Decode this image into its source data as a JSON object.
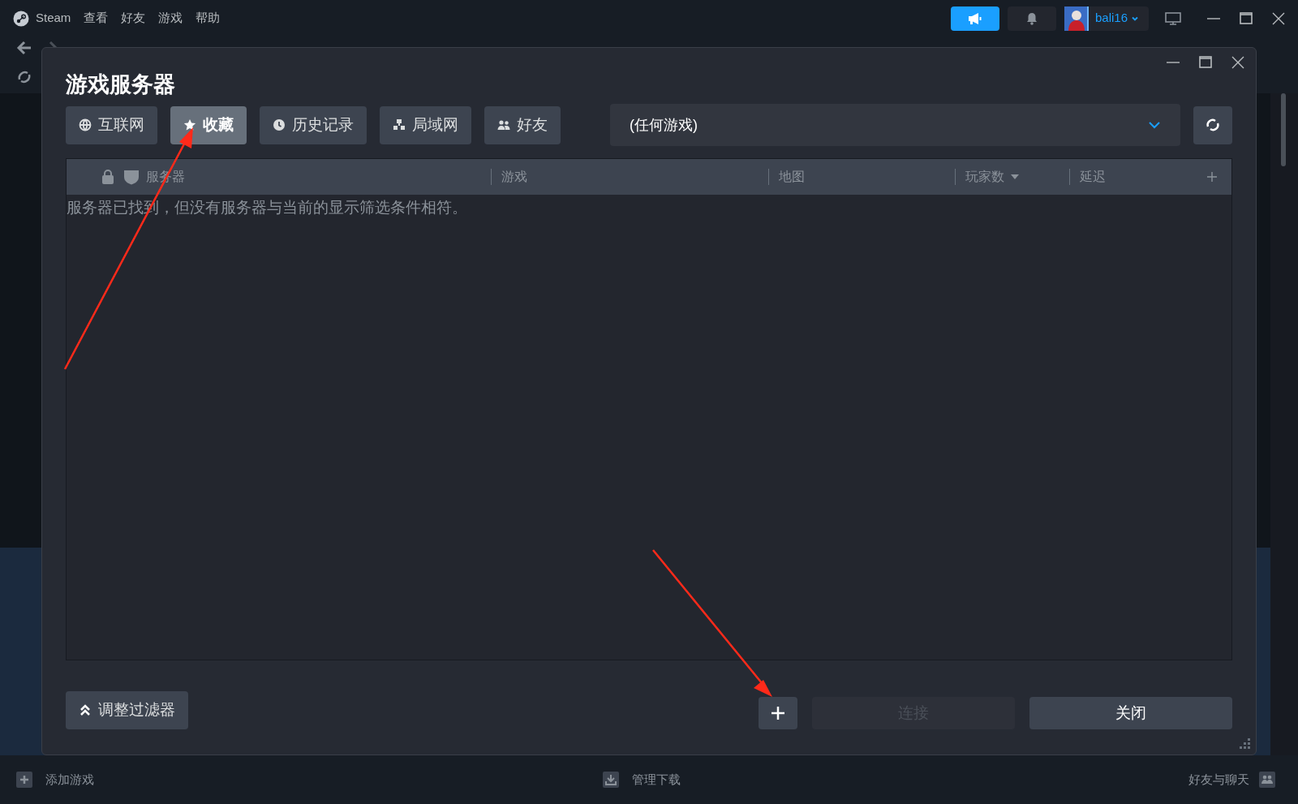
{
  "menubar": {
    "app": "Steam",
    "items": [
      "查看",
      "好友",
      "游戏",
      "帮助"
    ]
  },
  "header": {
    "username": "bali16"
  },
  "dialog": {
    "title": "游戏服务器",
    "tabs": [
      {
        "label": "互联网",
        "selected": false
      },
      {
        "label": "收藏",
        "selected": true
      },
      {
        "label": "历史记录",
        "selected": false
      },
      {
        "label": "局域网",
        "selected": false
      },
      {
        "label": "好友",
        "selected": false
      }
    ],
    "game_filter": {
      "value": "(任何游戏)"
    },
    "columns": [
      {
        "label": "服务器",
        "sorted": false
      },
      {
        "label": "游戏",
        "sorted": false
      },
      {
        "label": "地图",
        "sorted": false
      },
      {
        "label": "玩家数",
        "sorted": true
      },
      {
        "label": "延迟",
        "sorted": false
      }
    ],
    "empty_message": "服务器已找到，但没有服务器与当前的显示筛选条件相符。",
    "filter_button": "调整过滤器",
    "connect_button": {
      "label": "连接",
      "disabled": true
    },
    "close_button": "关闭"
  },
  "status_bar": {
    "add_game": "添加游戏",
    "downloads": "管理下载",
    "friends": "好友与聊天"
  }
}
